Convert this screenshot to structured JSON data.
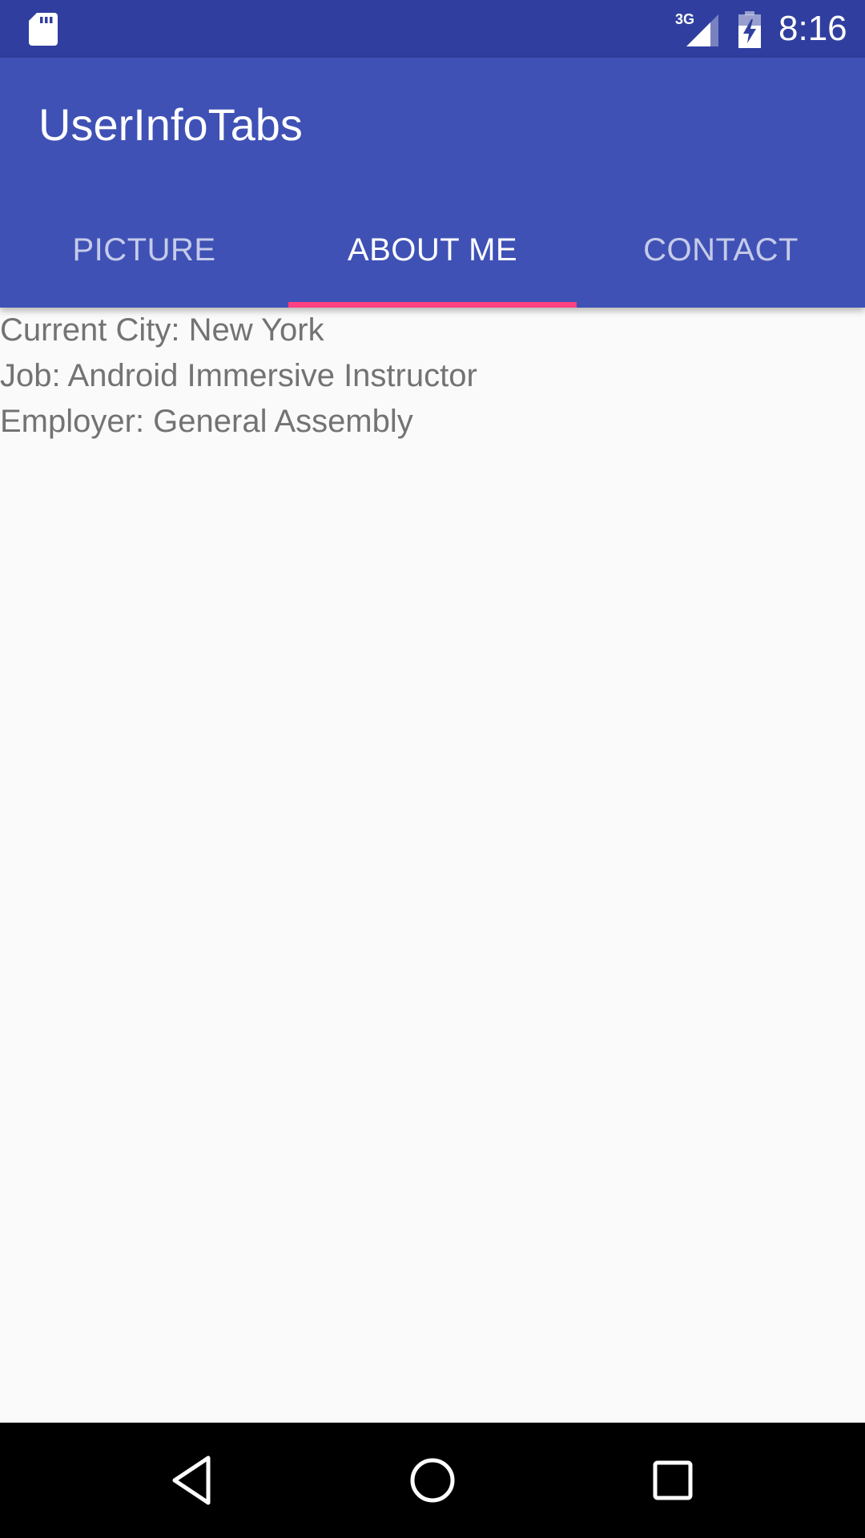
{
  "status_bar": {
    "time": "8:16",
    "network_type": "3G",
    "icons": [
      "sd-card-icon",
      "signal-3g-icon",
      "battery-charging-icon"
    ],
    "background_color": "#303f9f"
  },
  "app_bar": {
    "title": "UserInfoTabs",
    "background_color": "#3f51b5"
  },
  "tabs": [
    {
      "label": "PICTURE",
      "selected": false
    },
    {
      "label": "ABOUT ME",
      "selected": true
    },
    {
      "label": "CONTACT",
      "selected": false
    }
  ],
  "tab_indicator_color": "#ff4081",
  "about_me": {
    "current_city": "Current City: New York",
    "job": "Job: Android Immersive Instructor",
    "employer": "Employer: General Assembly"
  },
  "nav_bar": {
    "icons": [
      "back-icon",
      "home-icon",
      "recents-icon"
    ]
  }
}
